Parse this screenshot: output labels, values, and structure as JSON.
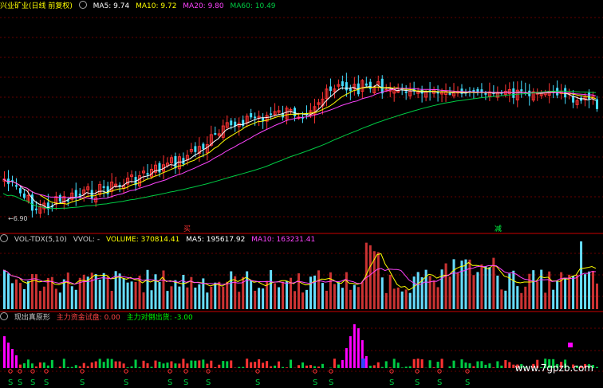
{
  "main_panel": {
    "title": "兴业矿业(日线 前复权)",
    "ma": [
      {
        "label": "MA5: 9.74",
        "color": "#ffffff"
      },
      {
        "label": "MA10: 9.72",
        "color": "#ffff00"
      },
      {
        "label": "MA20: 9.80",
        "color": "#ff44ff"
      },
      {
        "label": "MA60: 10.49",
        "color": "#00cc44"
      }
    ],
    "min_label": "6.90"
  },
  "volume_panel": {
    "title": "VOL-TDX(5,10)",
    "vvol": "VVOL: -",
    "items": [
      {
        "label": "VOLUME: 370814.41",
        "color": "#ffff00"
      },
      {
        "label": "MA5: 195617.92",
        "color": "#ffffff"
      },
      {
        "label": "MA10: 163231.41",
        "color": "#ff44ff"
      }
    ]
  },
  "indicator_panel": {
    "title": "现出真原形",
    "items": [
      {
        "label": "主力资金试盘: 0.00",
        "color": "#ff4444"
      },
      {
        "label": "主力对倒出货: -3.00",
        "color": "#00ff00"
      }
    ]
  },
  "markers": {
    "s_glyph": "S",
    "red_mark": "买",
    "green_mark": "减"
  },
  "watermark": "www.7gpzb.com"
}
